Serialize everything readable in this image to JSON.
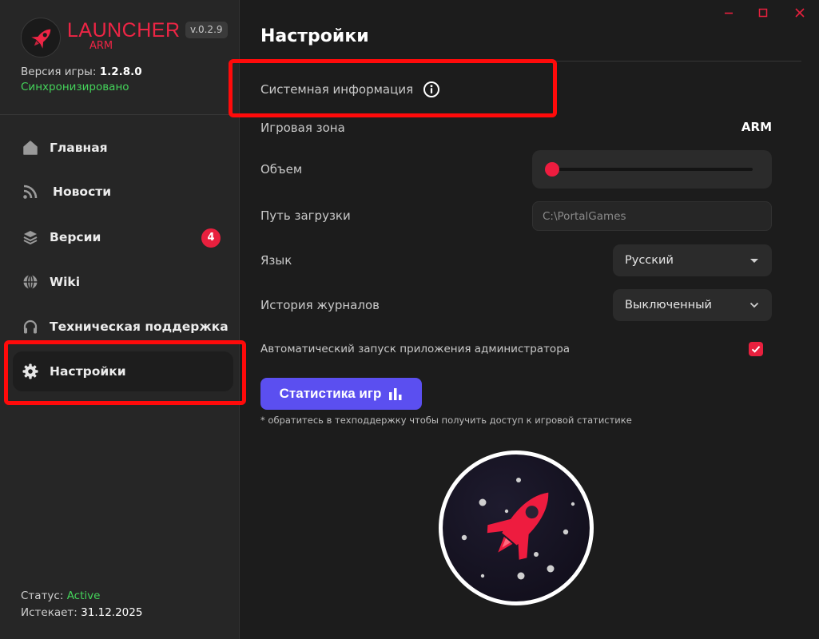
{
  "window": {
    "controls": [
      "minimize",
      "maximize",
      "close"
    ]
  },
  "sidebar": {
    "logo_title": "LAUNCHER",
    "logo_sub": "ARM",
    "launcher_version": "v.0.2.9",
    "game_version_label": "Версия игры:",
    "game_version_value": "1.2.8.0",
    "sync_status": "Синхронизировано",
    "items": [
      {
        "label": "Главная",
        "icon": "home-icon"
      },
      {
        "label": "Новости",
        "icon": "rss-icon"
      },
      {
        "label": "Версии",
        "icon": "layers-icon",
        "badge": "4"
      },
      {
        "label": "Wiki",
        "icon": "globe-icon"
      },
      {
        "label": "Техническая поддержка",
        "icon": "headphones-icon"
      },
      {
        "label": "Настройки",
        "icon": "gear-icon",
        "active": true
      }
    ],
    "status_label": "Статус:",
    "status_value": "Active",
    "expires_label": "Истекает:",
    "expires_value": "31.12.2025"
  },
  "settings": {
    "title": "Настройки",
    "system_info_label": "Системная информация",
    "zone_label": "Игровая зона",
    "zone_value": "ARM",
    "volume_label": "Объем",
    "volume_level": 0,
    "path_label": "Путь загрузки",
    "path_placeholder": "C:\\PortalGames",
    "language_label": "Язык",
    "language_value": "Русский",
    "log_history_label": "История журналов",
    "log_history_value": "Выключенный",
    "auto_admin_label": "Автоматический запуск приложения администратора",
    "auto_admin_checked": true,
    "stats_button_label": "Статистика игр",
    "footnote": "* обратитесь в техподдержку чтобы получить доступ к игровой статистике"
  },
  "colors": {
    "accent": "#ee1c3f",
    "brand": "#ee2545",
    "success": "#44d35a",
    "button": "#5b4ff0"
  }
}
